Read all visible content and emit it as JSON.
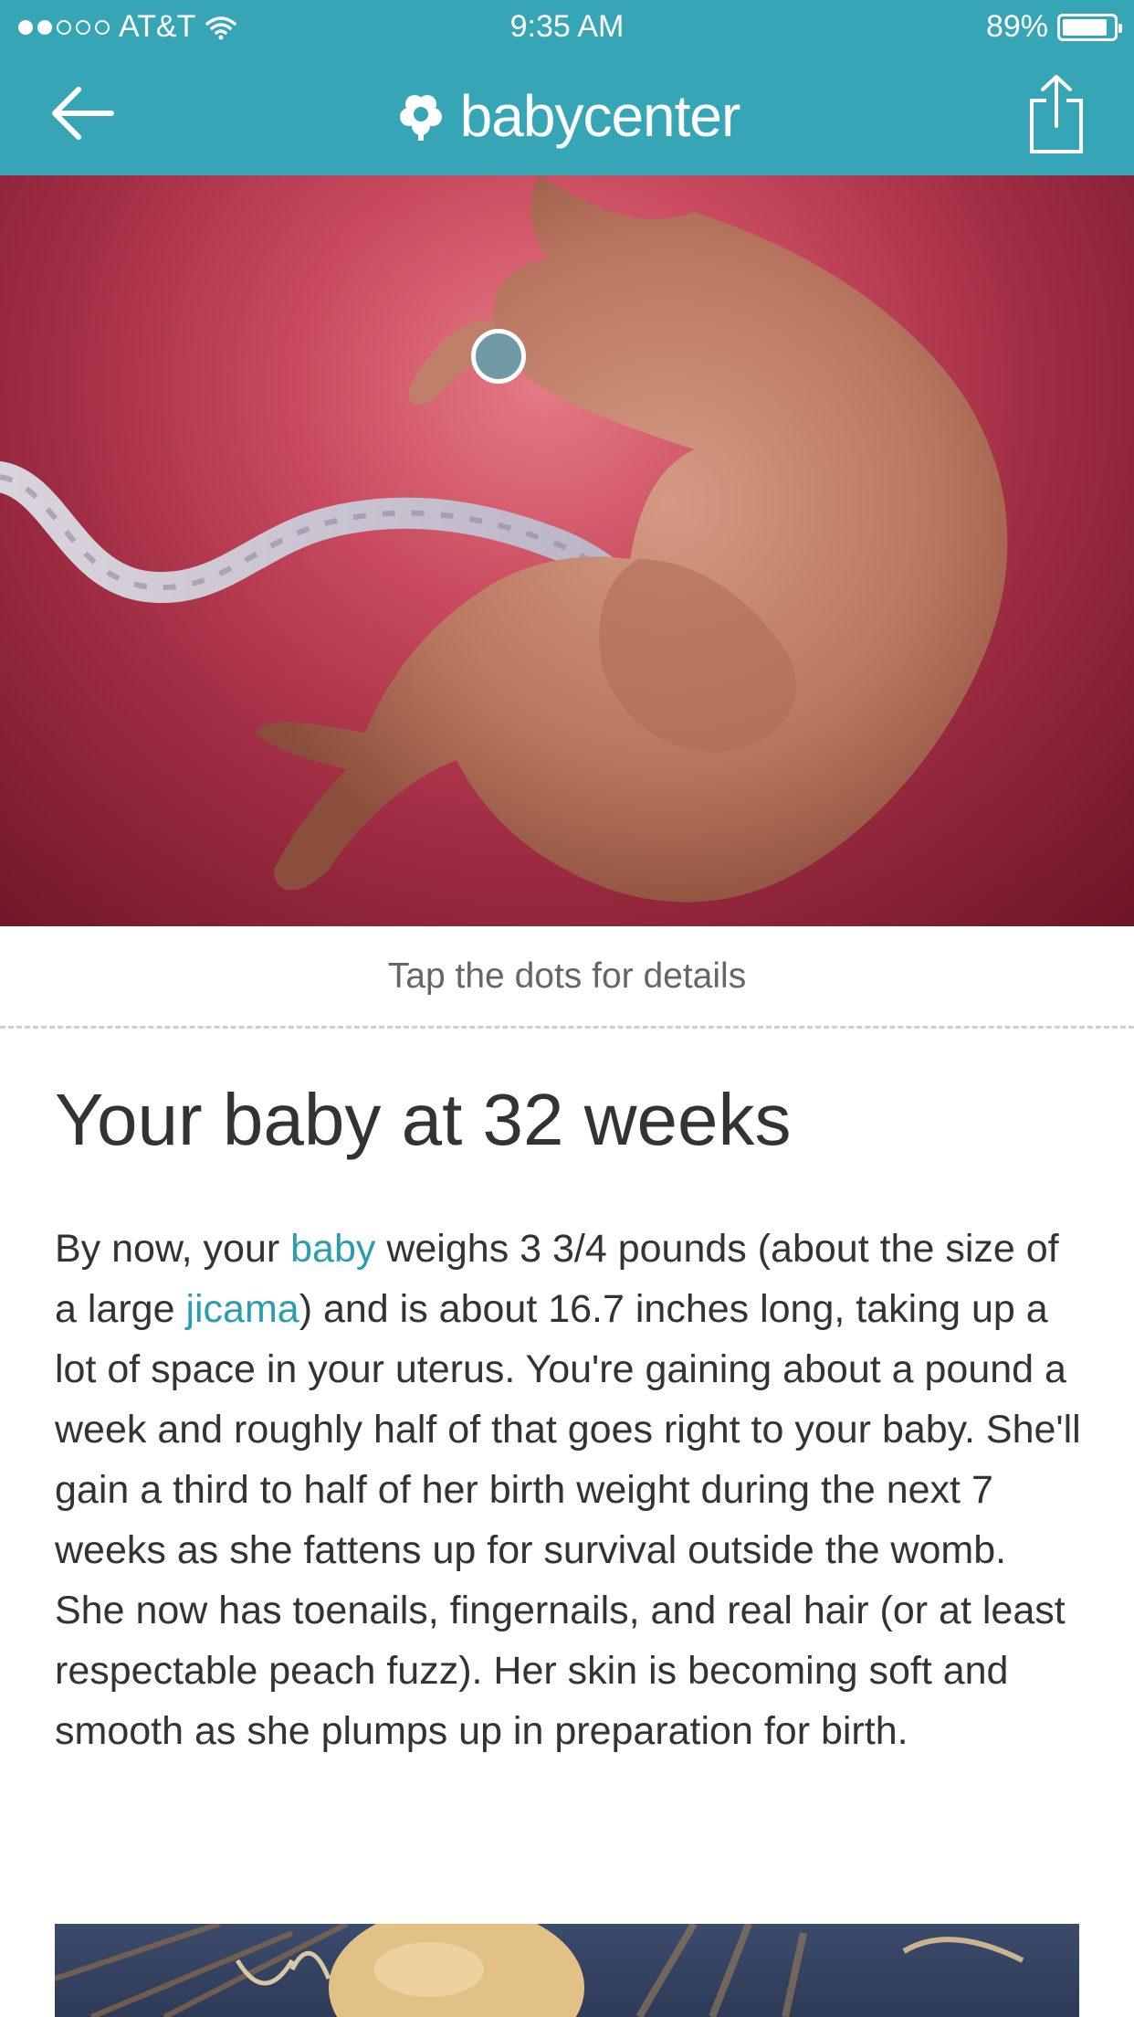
{
  "status_bar": {
    "carrier": "AT&T",
    "time": "9:35 AM",
    "battery": "89%",
    "battery_level": 0.89,
    "signal_bars_filled": 2,
    "signal_bars_total": 5
  },
  "navbar": {
    "brand": "babycenter",
    "back_icon": "arrow-left-icon",
    "share_icon": "share-icon",
    "color": "#36a5b6"
  },
  "hero": {
    "image_icon": "fetus-illustration",
    "hotspot_icon": "hotspot-dot"
  },
  "caption": "Tap the dots for details",
  "article": {
    "title": "Your baby at 32 weeks",
    "body_1": "By now, your ",
    "link_baby": "baby",
    "body_2": " weighs 3 3/4 pounds (about the size of a large ",
    "link_jicama": "jicama",
    "body_3": ") and is about 16.7 inches long, taking up a lot of space in your uterus. You're gaining about a pound a week and roughly half of that goes right to your baby. She'll gain a third to half of her birth weight during the next 7 weeks as she fattens up for survival outside the womb. She now has toenails, fingernails, and real hair (or at least respectable peach fuzz). Her skin is becoming soft and smooth as she plumps up in preparation for birth.",
    "link_color": "#2a9eaf"
  },
  "footer_image": {
    "icon": "jicama-photo"
  }
}
